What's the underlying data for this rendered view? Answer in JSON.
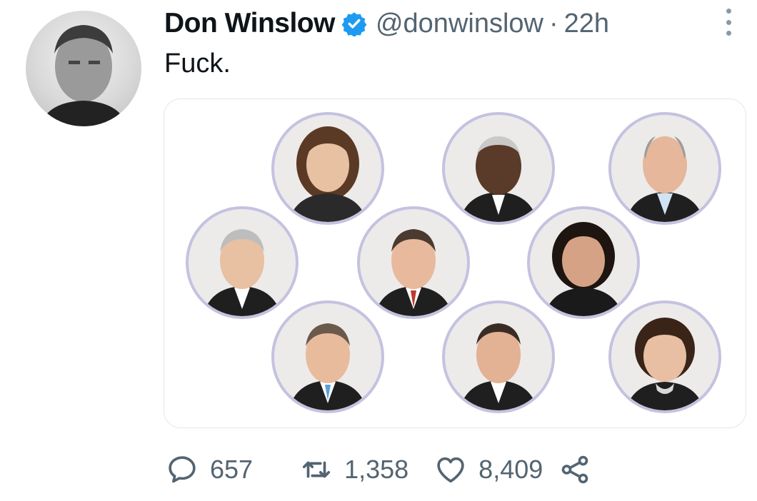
{
  "tweet": {
    "author_name": "Don Winslow",
    "handle": "@donwinslow",
    "separator": "·",
    "time": "22h",
    "text": "Fuck.",
    "verified": true
  },
  "icons": {
    "verified": "verified-badge-icon",
    "more": "more-options-icon",
    "reply": "reply-icon",
    "retweet": "retweet-icon",
    "like": "heart-icon",
    "share": "share-icon"
  },
  "actions": {
    "replies": "657",
    "retweets": "1,358",
    "likes": "8,409"
  },
  "colors": {
    "verified": "#1d9bf0",
    "secondary_text": "#536471",
    "portrait_ring": "#c5c2e0"
  }
}
